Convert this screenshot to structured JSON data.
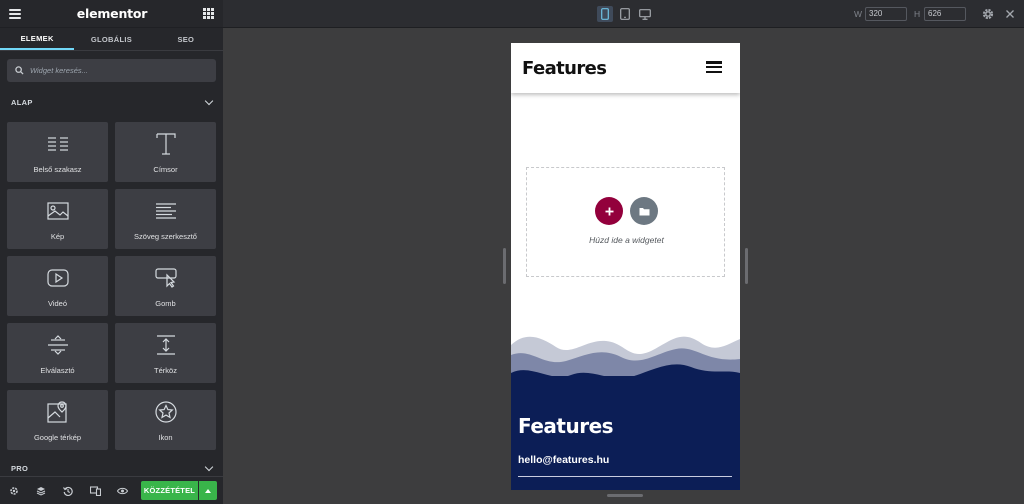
{
  "panel": {
    "title": "elementor",
    "tabs": [
      "ELEMEK",
      "GLOBÁLIS",
      "SEO"
    ],
    "active_tab": "ELEMEK",
    "search_placeholder": "Widget keresés...",
    "sections": {
      "basic": "ALAP",
      "pro": "PRO"
    },
    "widgets": [
      {
        "label": "Belső szakasz",
        "icon": "inner-section-icon"
      },
      {
        "label": "Címsor",
        "icon": "heading-icon"
      },
      {
        "label": "Kép",
        "icon": "image-icon"
      },
      {
        "label": "Szöveg szerkesztő",
        "icon": "text-editor-icon"
      },
      {
        "label": "Videó",
        "icon": "video-icon"
      },
      {
        "label": "Gomb",
        "icon": "button-icon"
      },
      {
        "label": "Elválasztó",
        "icon": "divider-icon"
      },
      {
        "label": "Térköz",
        "icon": "spacer-icon"
      },
      {
        "label": "Google térkép",
        "icon": "map-icon"
      },
      {
        "label": "Ikon",
        "icon": "star-icon"
      }
    ],
    "footer": {
      "publish_label": "KÖZZÉTÉTEL",
      "icons": [
        "settings-icon",
        "navigator-icon",
        "history-icon",
        "responsive-icon",
        "preview-eye-icon"
      ]
    }
  },
  "topbar": {
    "devices": [
      "mobile",
      "tablet",
      "desktop"
    ],
    "active_device": "mobile",
    "width_label": "W",
    "height_label": "H",
    "width_value": "320",
    "height_value": "626"
  },
  "preview": {
    "header_logo": "Features",
    "dropzone_text": "Húzd ide a widgetet",
    "footer_title": "Features",
    "footer_email": "hello@features.hu"
  },
  "colors": {
    "panel_bg": "#26272b",
    "accent_tab": "#71d7f7",
    "publish_green": "#39b54a",
    "add_button": "#93003c",
    "footer_navy": "#0c1e56"
  }
}
